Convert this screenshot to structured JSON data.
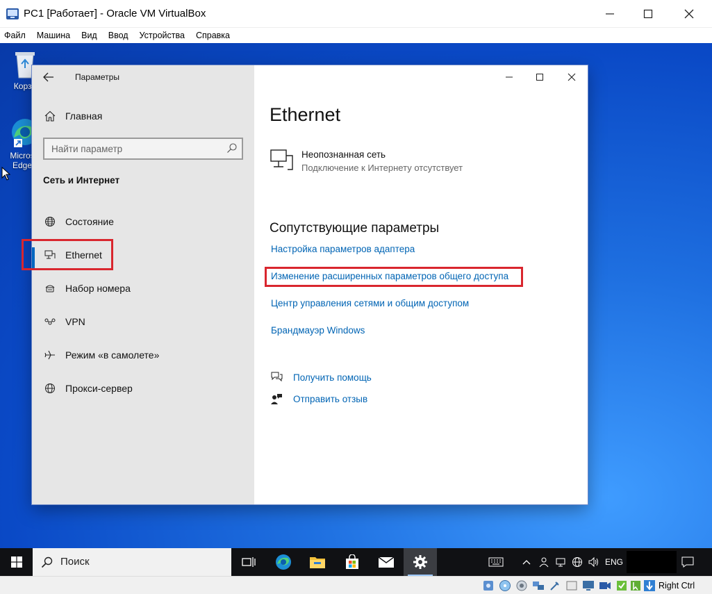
{
  "vbox": {
    "title": "PC1 [Работает] - Oracle VM VirtualBox",
    "menu": [
      "Файл",
      "Машина",
      "Вид",
      "Ввод",
      "Устройства",
      "Справка"
    ],
    "host_key": "Right Ctrl"
  },
  "desktop": {
    "icons": [
      {
        "label": "Корзи",
        "icon": "recycle-bin-icon"
      },
      {
        "label_line1": "Micros",
        "label_line2": "Edge",
        "icon": "edge-icon"
      }
    ]
  },
  "settings": {
    "caption": "Параметры",
    "home": "Главная",
    "search_placeholder": "Найти параметр",
    "section": "Сеть и Интернет",
    "nav": [
      {
        "label": "Состояние",
        "icon": "globe-icon"
      },
      {
        "label": "Ethernet",
        "icon": "ethernet-icon"
      },
      {
        "label": "Набор номера",
        "icon": "dialup-icon"
      },
      {
        "label": "VPN",
        "icon": "vpn-icon"
      },
      {
        "label": "Режим «в самолете»",
        "icon": "airplane-icon"
      },
      {
        "label": "Прокси-сервер",
        "icon": "proxy-globe-icon"
      }
    ],
    "page_title": "Ethernet",
    "network": {
      "name": "Неопознанная сеть",
      "status": "Подключение к Интернету отсутствует"
    },
    "related_title": "Сопутствующие параметры",
    "related_links": [
      "Настройка параметров адаптера",
      "Изменение расширенных параметров общего доступа",
      "Центр управления сетями и общим доступом",
      "Брандмауэр Windows"
    ],
    "help": "Получить помощь",
    "feedback": "Отправить отзыв"
  },
  "taskbar": {
    "search_placeholder": "Поиск",
    "lang": "ENG"
  },
  "colors": {
    "accent": "#0067c0",
    "link": "#0064b4",
    "highlight_frame": "#d9262e",
    "taskbar": "#101114"
  }
}
